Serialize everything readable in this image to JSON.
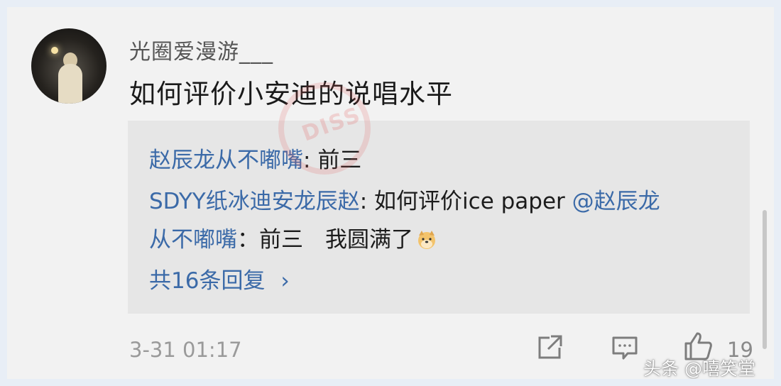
{
  "comment": {
    "username": "光圈爱漫游___",
    "text": "如何评价小安迪的说唱水平",
    "timestamp": "3-31 01:17",
    "like_count": "19"
  },
  "replies": {
    "r1": {
      "user": "赵辰龙从不嘟嘴",
      "sep": ": ",
      "text": "前三"
    },
    "r2": {
      "user": "SDYY纸冰迪安龙辰赵",
      "sep": ": ",
      "text": "如何评价ice paper ",
      "mention": "@赵辰龙"
    },
    "r3": {
      "mention": "从不嘟嘴",
      "text": "：前三　我圆满了"
    },
    "more_label": "共16条回复",
    "more_chevron": "›"
  },
  "watermark": {
    "text": "DISS"
  },
  "icons": [
    "share-icon",
    "comment-icon",
    "like-icon",
    "dog-emoji"
  ],
  "credit": "头条 @嘻笑堂",
  "colors": {
    "link": "#3b6aa8",
    "background": "#f2f2f2",
    "reply_bg": "#e6e6e6"
  }
}
